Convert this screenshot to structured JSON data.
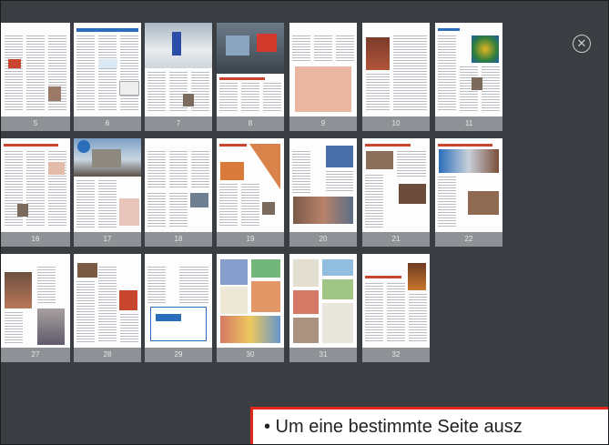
{
  "viewer": {
    "close_icon": "close-circle-icon",
    "close_glyph": "✕"
  },
  "pages": [
    {
      "label": "5"
    },
    {
      "label": "6"
    },
    {
      "label": "7"
    },
    {
      "label": "8"
    },
    {
      "label": "9"
    },
    {
      "label": "10"
    },
    {
      "label": "11"
    },
    {
      "label": "16"
    },
    {
      "label": "17"
    },
    {
      "label": "18"
    },
    {
      "label": "19"
    },
    {
      "label": "20"
    },
    {
      "label": "21"
    },
    {
      "label": "22"
    },
    {
      "label": "27"
    },
    {
      "label": "28"
    },
    {
      "label": "29"
    },
    {
      "label": "30"
    },
    {
      "label": "31"
    },
    {
      "label": "32"
    }
  ],
  "tooltip": {
    "text": "• Um eine bestimmte Seite ausz"
  },
  "colors": {
    "background": "#3a3d42",
    "label_bar": "#8e9196",
    "tooltip_border": "#e2271c"
  }
}
